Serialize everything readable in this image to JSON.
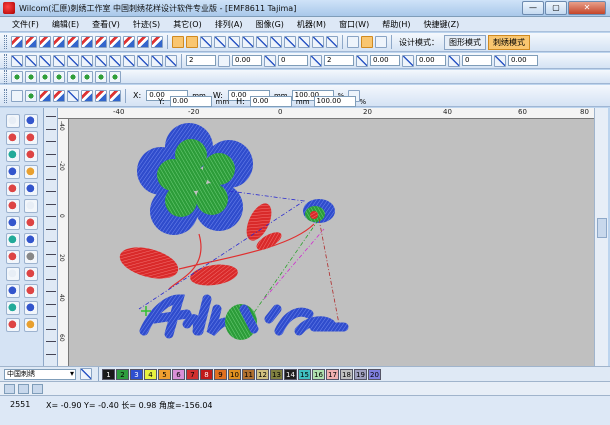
{
  "window": {
    "title": "Wilcom(汇原)刺绣工作室  中国刺绣花样设计软件专业版 - [EMF8611  Tajima]"
  },
  "menu": [
    "文件(F)",
    "编辑(E)",
    "查看(V)",
    "针迹(S)",
    "其它(O)",
    "排列(A)",
    "图像(G)",
    "机器(M)",
    "窗口(W)",
    "帮助(H)",
    "快捷键(Z)"
  ],
  "toolbar": {
    "design_mode_label": "设计模式：",
    "shape_mode_button": "图形模式",
    "embroidery_mode_button": "刺绣模式"
  },
  "props": {
    "spinners": [
      "2",
      "0.00",
      "0",
      "2",
      "0.00",
      "0.00",
      "0",
      "0.00"
    ]
  },
  "transform": {
    "x_label": "X:",
    "x_value": "0.00",
    "x_unit": "mm",
    "y_label": "Y:",
    "y_value": "0.00",
    "y_unit": "mm",
    "w_label": "W:",
    "w_value": "0.00",
    "w_unit": "mm",
    "h_label": "H:",
    "h_value": "0.00",
    "h_unit": "mm",
    "sx_value": "100.00",
    "sx_unit": "%",
    "sy_value": "100.00",
    "sy_unit": "%"
  },
  "ruler": {
    "h_ticks": [
      "-40",
      "-20",
      "0",
      "20",
      "40",
      "60",
      "80"
    ],
    "v_ticks": [
      "-40",
      "-20",
      "0",
      "20",
      "40",
      "60"
    ]
  },
  "colorbar": {
    "thread_set": "中国刺绣",
    "swatches": [
      {
        "n": "1",
        "c": "#1a1a1a"
      },
      {
        "n": "2",
        "c": "#2e9e3e"
      },
      {
        "n": "3",
        "c": "#2e4fcf"
      },
      {
        "n": "4",
        "c": "#e8f040"
      },
      {
        "n": "5",
        "c": "#f0a030"
      },
      {
        "n": "6",
        "c": "#d890d8"
      },
      {
        "n": "7",
        "c": "#d03030"
      },
      {
        "n": "8",
        "c": "#c01a1a"
      },
      {
        "n": "9",
        "c": "#e07020"
      },
      {
        "n": "10",
        "c": "#e09020"
      },
      {
        "n": "11",
        "c": "#b07030"
      },
      {
        "n": "12",
        "c": "#d0c080"
      },
      {
        "n": "13",
        "c": "#808040"
      },
      {
        "n": "14",
        "c": "#202020"
      },
      {
        "n": "15",
        "c": "#40c0c0"
      },
      {
        "n": "16",
        "c": "#b0e0b0"
      },
      {
        "n": "17",
        "c": "#f0b0b0"
      },
      {
        "n": "18",
        "c": "#c0c0c0"
      },
      {
        "n": "19",
        "c": "#a0a0c0"
      },
      {
        "n": "20",
        "c": "#8080e0"
      }
    ]
  },
  "status": {
    "stitch_count": "2551",
    "coords": "X=  -0.90 Y=  -0.40 长=    0.98 角度=-156.04"
  }
}
